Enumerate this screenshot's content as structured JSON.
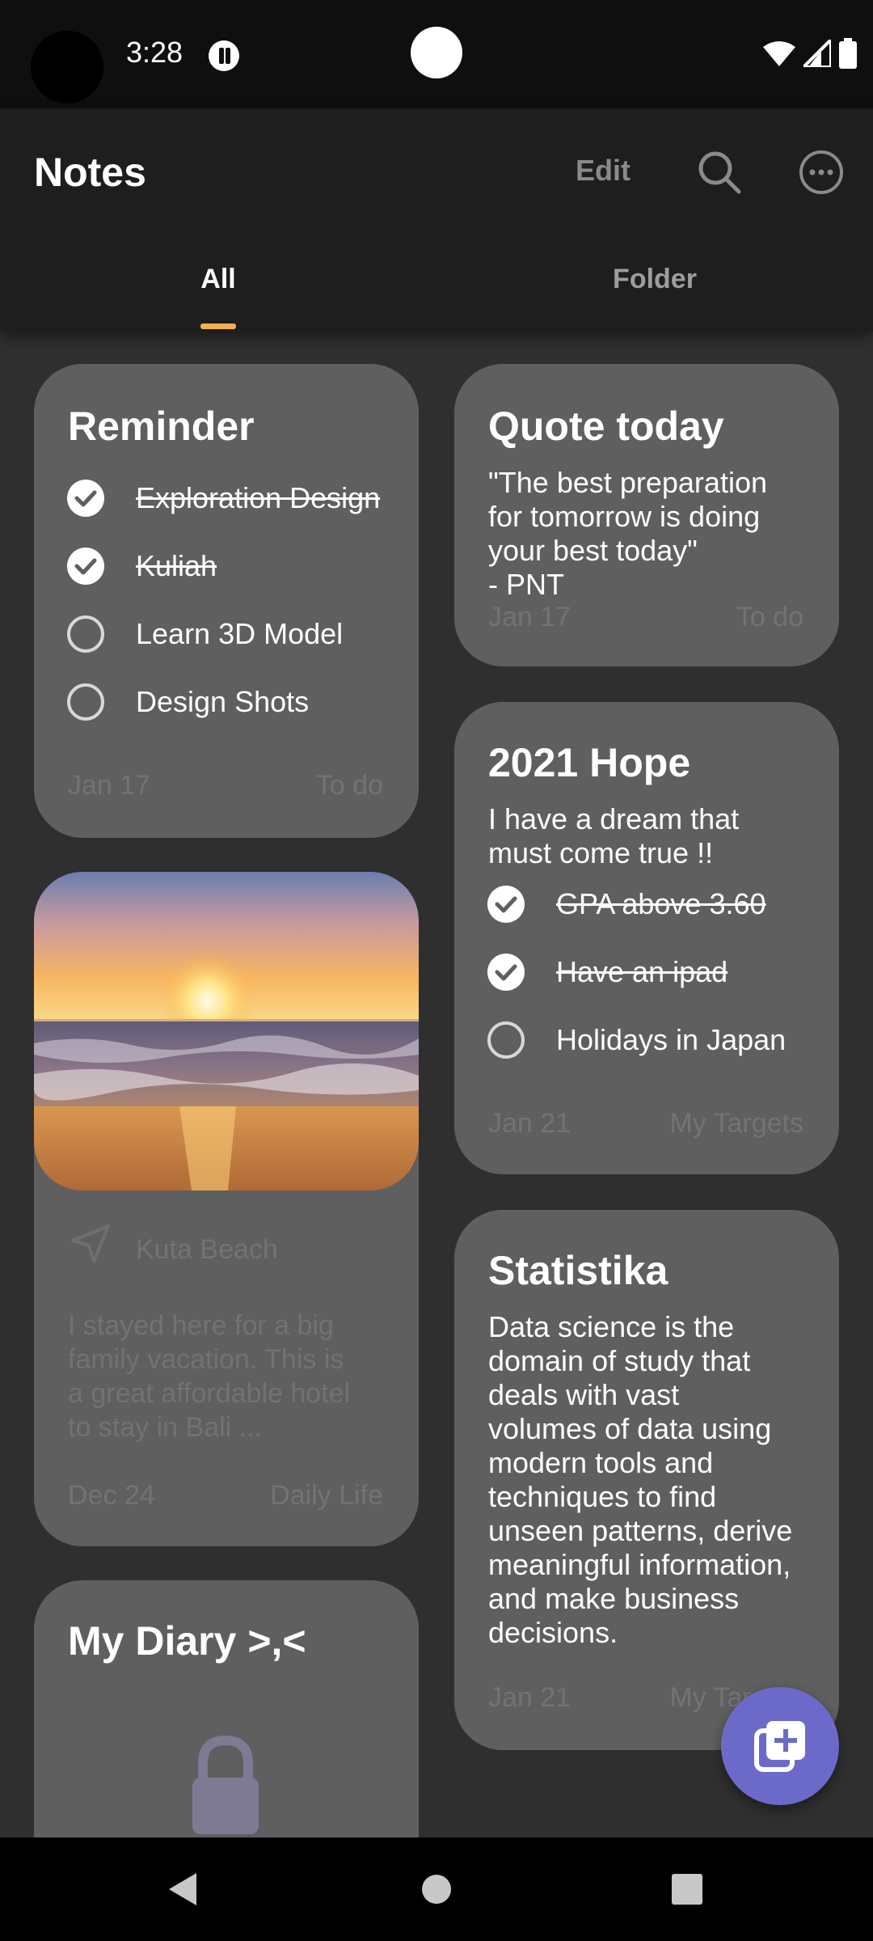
{
  "status_bar": {
    "time": "3:28"
  },
  "app_bar": {
    "title": "Notes",
    "edit_label": "Edit",
    "tabs": [
      {
        "label": "All",
        "selected": true
      },
      {
        "label": "Folder",
        "selected": false
      }
    ]
  },
  "colors": {
    "accent": "#f0b14d",
    "fab": "#6c6ac8",
    "card": "#5f5f5f",
    "background": "#2f2f2f"
  },
  "cards": {
    "reminder": {
      "title": "Reminder",
      "items": [
        {
          "label": "Exploration Design",
          "done": true
        },
        {
          "label": "Kuliah",
          "done": true
        },
        {
          "label": "Learn 3D Model",
          "done": false
        },
        {
          "label": "Design Shots",
          "done": false
        }
      ],
      "date": "Jan 17",
      "folder": "To do"
    },
    "quote": {
      "title": "Quote today",
      "lines": [
        "\"The best preparation",
        "for tomorrow is doing",
        "your best today\"",
        "- PNT"
      ],
      "date": "Jan 17",
      "folder": "To do"
    },
    "beach": {
      "location": "Kuta Beach",
      "lines": [
        "I stayed here for a big",
        "family vacation. This is",
        "a great affordable hotel",
        "to stay in Bali ..."
      ],
      "date": "Dec 24",
      "folder": "Daily Life"
    },
    "hope": {
      "title": "2021 Hope",
      "lines": [
        "I have a dream that",
        "must come true !!"
      ],
      "items": [
        {
          "label": "GPA above 3.60",
          "done": true
        },
        {
          "label": "Have an ipad",
          "done": true
        },
        {
          "label": "Holidays in Japan",
          "done": false
        }
      ],
      "date": "Jan 21",
      "folder": "My Targets"
    },
    "statistika": {
      "title": "Statistika",
      "lines": [
        "Data science is the",
        "domain of study that",
        "deals with vast",
        "volumes of data using",
        "modern tools and",
        "techniques to find",
        "unseen patterns, derive",
        "meaningful information,",
        "and make business",
        "decisions."
      ],
      "date": "Jan 21",
      "folder": "My Targets"
    },
    "diary": {
      "title": "My Diary >,<",
      "locked": true
    }
  },
  "icons": {
    "search": "search-icon",
    "more": "more-icon",
    "location": "navigation-arrow-icon",
    "lock": "lock-icon",
    "fab": "add-note-icon"
  }
}
